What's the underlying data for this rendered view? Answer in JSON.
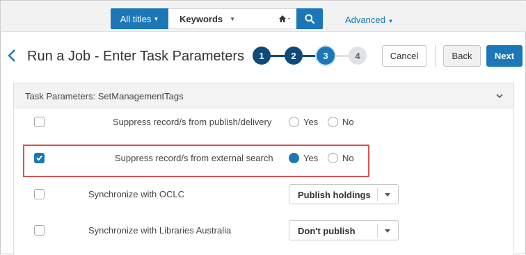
{
  "search": {
    "scope_label": "All titles",
    "field_label": "Keywords",
    "advanced_label": "Advanced"
  },
  "header": {
    "title": "Run a Job - Enter Task Parameters",
    "steps": [
      "1",
      "2",
      "3",
      "4"
    ],
    "current_step": 3,
    "cancel_label": "Cancel",
    "back_label": "Back",
    "next_label": "Next"
  },
  "panel": {
    "title": "Task Parameters: SetManagementTags",
    "rows": [
      {
        "label": "Suppress record/s from publish/delivery",
        "checked": false,
        "yes": "Yes",
        "no": "No",
        "selected": "none"
      },
      {
        "label": "Suppress record/s from external search",
        "checked": true,
        "yes": "Yes",
        "no": "No",
        "selected": "Yes"
      },
      {
        "label": "Synchronize with OCLC",
        "checked": false,
        "dropdown_value": "Publish holdings"
      },
      {
        "label": "Synchronize with Libraries Australia",
        "checked": false,
        "dropdown_value": "Don't publish"
      }
    ]
  },
  "colors": {
    "primary": "#1b77b8",
    "step_dark": "#0f4a7a",
    "step_light": "#dfe3e7",
    "highlight": "#d9534f"
  },
  "icons": [
    "home-icon",
    "search-icon",
    "chevron-left-icon",
    "chevron-down-icon",
    "checkmark-icon"
  ]
}
